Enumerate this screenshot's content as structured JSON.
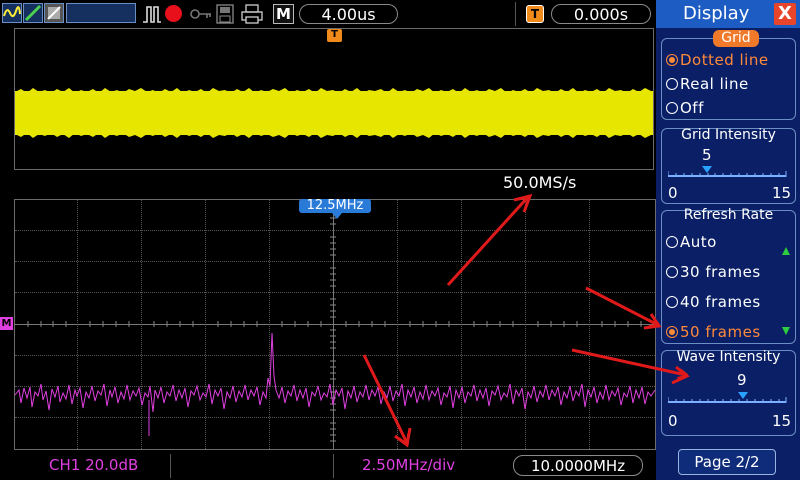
{
  "topbar": {
    "timebase": "4.00us",
    "trigger_offset": "0.000s",
    "mode_letter": "M",
    "trigger_letter": "T",
    "icons": [
      "waveform-icon",
      "cursor-icon",
      "zoom-icon",
      "pulse-icon",
      "record-icon",
      "key-icon",
      "save-icon",
      "print-icon"
    ]
  },
  "ch1_window": {
    "trigger_marker": "T",
    "sample_rate": "50.0MS/s",
    "trace_color": "#e6e600"
  },
  "fft_window": {
    "center_marker": "12.5MHz",
    "ref_marker": "M",
    "trace_color": "#e040e0"
  },
  "statusbar": {
    "channel_scale": "CH1 20.0dB",
    "freq_per_div": "2.50MHz/div",
    "frequency": "10.0000MHz"
  },
  "menu": {
    "title": "Display",
    "close_label": "X",
    "grid": {
      "title": "Grid",
      "options": [
        "Dotted line",
        "Real line",
        "Off"
      ],
      "selected": "Dotted line"
    },
    "grid_intensity": {
      "title": "Grid Intensity",
      "value": "5",
      "min": "0",
      "max": "15"
    },
    "refresh_rate": {
      "title": "Refresh Rate",
      "options": [
        "Auto",
        "30 frames",
        "40 frames",
        "50 frames"
      ],
      "selected": "50 frames"
    },
    "wave_intensity": {
      "title": "Wave Intensity",
      "value": "9",
      "min": "0",
      "max": "15"
    },
    "page_label": "Page 2/2"
  },
  "colors": {
    "menu_bg": "#0a1f66",
    "accent_orange": "#ff8a3a",
    "annotation_red": "#e01a1a"
  }
}
